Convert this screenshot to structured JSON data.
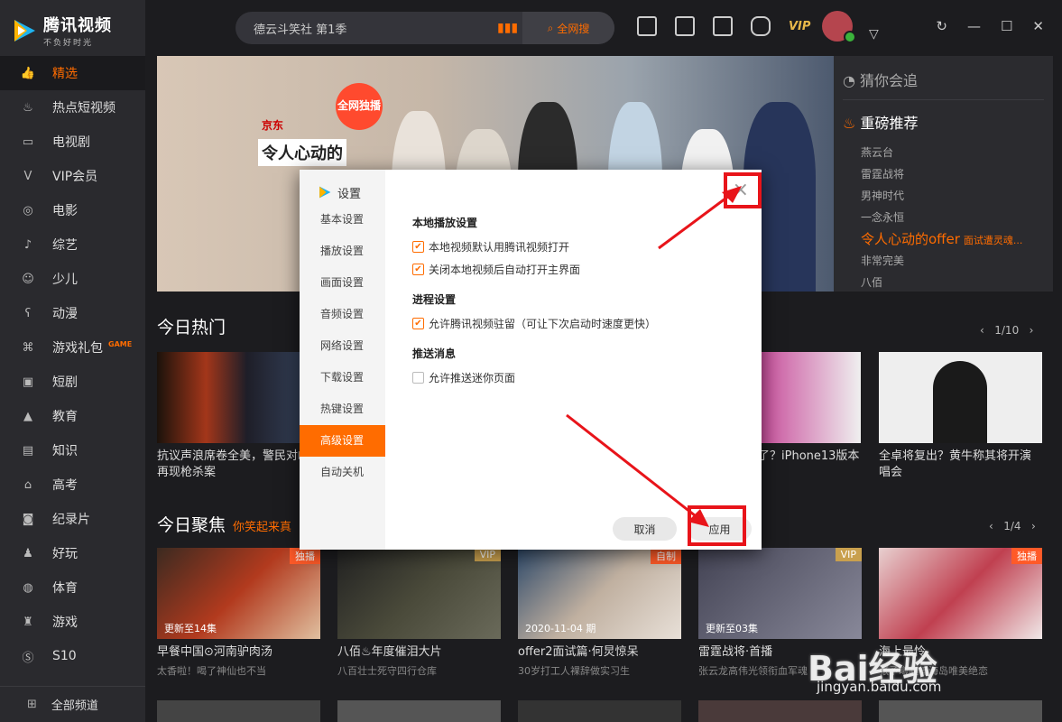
{
  "app": {
    "name": "腾讯视频",
    "slogan": "不负好时光"
  },
  "sidebar": {
    "items": [
      {
        "label": "精选",
        "icon": "thumb-up-icon"
      },
      {
        "label": "热点短视频",
        "icon": "flame-icon"
      },
      {
        "label": "电视剧",
        "icon": "tv-icon"
      },
      {
        "label": "VIP会员",
        "icon": "vip-icon"
      },
      {
        "label": "电影",
        "icon": "film-reel-icon"
      },
      {
        "label": "综艺",
        "icon": "mic-icon"
      },
      {
        "label": "少儿",
        "icon": "kid-icon"
      },
      {
        "label": "动漫",
        "icon": "bear-icon"
      },
      {
        "label": "游戏礼包",
        "icon": "gamepad-icon",
        "tag": "GAME"
      },
      {
        "label": "短剧",
        "icon": "clip-icon"
      },
      {
        "label": "教育",
        "icon": "graduation-icon"
      },
      {
        "label": "知识",
        "icon": "book-icon"
      },
      {
        "label": "高考",
        "icon": "exam-icon"
      },
      {
        "label": "纪录片",
        "icon": "camera-icon"
      },
      {
        "label": "好玩",
        "icon": "joystick-icon"
      },
      {
        "label": "体育",
        "icon": "ball-icon"
      },
      {
        "label": "游戏",
        "icon": "trophy-icon"
      },
      {
        "label": "S10",
        "icon": "s10-icon"
      }
    ],
    "all_channels": "全部频道"
  },
  "search": {
    "value": "德云斗笑社 第1季",
    "button": "全网搜"
  },
  "topbar": {
    "vip": "VIP"
  },
  "banner": {
    "badge": "全网独播",
    "title": "令人心动的",
    "sponsor": "京东"
  },
  "recommend": {
    "guess": "猜你会追",
    "hot": "重磅推荐",
    "items": [
      "燕云台",
      "雷霆战将",
      "男神时代",
      "一念永恒",
      "令人心动的offer",
      "非常完美",
      "八佰"
    ],
    "highlight_sub": "面试遭灵魂..."
  },
  "hot_today": {
    "title": "今日热门",
    "pager": "1/10",
    "cards": [
      {
        "caption": "抗议声浪席卷全美，警民对峙再现枪杀案"
      },
      {
        "caption": "了？iPhone13版本"
      },
      {
        "caption": "全卓将复出？黄牛称其将开演唱会"
      }
    ]
  },
  "focus_today": {
    "title": "今日聚焦",
    "subtitle": "你笑起来真",
    "pager": "1/4",
    "cards": [
      {
        "caption": "早餐中国⊙河南驴肉汤",
        "sub": "太香啦！喝了神仙也不当",
        "tag": "独播",
        "ep": "更新至14集"
      },
      {
        "caption": "八佰♨年度催泪大片",
        "sub": "八百壮士死守四行仓库",
        "tag": "VIP",
        "ep": ""
      },
      {
        "caption": "offer2面试篇·何炅惊呆",
        "sub": "30岁打工人裸辞做实习生",
        "tag": "自制",
        "ep": "2020-11-04 期"
      },
      {
        "caption": "雷霆战将·首播",
        "sub": "张云龙高伟光领衔血军魂",
        "tag": "VIP",
        "ep": "更新至03集"
      },
      {
        "caption": "海上最怜",
        "sub": "张予曦赵梓海岛唯美绝恋",
        "tag": "独播",
        "ep": ""
      }
    ]
  },
  "settings_dialog": {
    "title": "设置",
    "nav": [
      "基本设置",
      "播放设置",
      "画面设置",
      "音频设置",
      "网络设置",
      "下载设置",
      "热键设置",
      "高级设置",
      "自动关机"
    ],
    "active_index": 7,
    "groups": [
      {
        "title": "本地播放设置",
        "options": [
          {
            "label": "本地视频默认用腾讯视频打开",
            "checked": true
          },
          {
            "label": "关闭本地视频后自动打开主界面",
            "checked": true
          }
        ]
      },
      {
        "title": "进程设置",
        "options": [
          {
            "label": "允许腾讯视频驻留（可让下次启动时速度更快）",
            "checked": true
          }
        ]
      },
      {
        "title": "推送消息",
        "options": [
          {
            "label": "允许推送迷你页面",
            "checked": false
          }
        ]
      }
    ],
    "cancel": "取消",
    "apply": "应用",
    "close": "×"
  },
  "watermark": {
    "brand": "Bai经验",
    "url": "jingyan.baidu.com"
  },
  "colors": {
    "accent": "#ff6c00",
    "annotation": "#e8141a"
  }
}
